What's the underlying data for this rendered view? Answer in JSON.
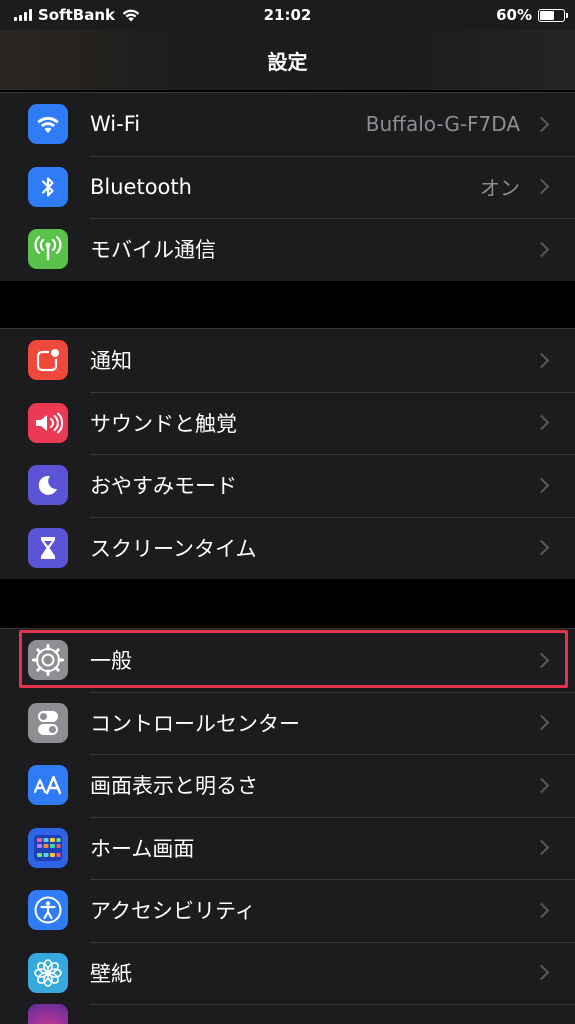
{
  "status_bar": {
    "carrier": "SoftBank",
    "time": "21:02",
    "battery_percent": "60%",
    "battery_level": 0.6,
    "icons": [
      "signal-icon",
      "wifi-icon",
      "battery-icon"
    ]
  },
  "nav": {
    "title": "設定"
  },
  "groups": [
    {
      "items": [
        {
          "label": "Wi-Fi",
          "value": "Buffalo-G-F7DA",
          "icon": "wifi-icon",
          "color": "#2f7cf6"
        },
        {
          "label": "Bluetooth",
          "value": "オン",
          "icon": "bluetooth-icon",
          "color": "#2f7cf6"
        },
        {
          "label": "モバイル通信",
          "value": "",
          "icon": "antenna-icon",
          "color": "#5ac14a"
        }
      ]
    },
    {
      "items": [
        {
          "label": "通知",
          "value": "",
          "icon": "notifications-icon",
          "color": "#f0483a"
        },
        {
          "label": "サウンドと触覚",
          "value": "",
          "icon": "speaker-icon",
          "color": "#ec3a55"
        },
        {
          "label": "おやすみモード",
          "value": "",
          "icon": "moon-icon",
          "color": "#5b54d6"
        },
        {
          "label": "スクリーンタイム",
          "value": "",
          "icon": "hourglass-icon",
          "color": "#5b54d6"
        }
      ]
    },
    {
      "items": [
        {
          "label": "一般",
          "value": "",
          "icon": "gear-icon",
          "color": "#8e8e93",
          "highlighted": true
        },
        {
          "label": "コントロールセンター",
          "value": "",
          "icon": "toggles-icon",
          "color": "#8e8e93"
        },
        {
          "label": "画面表示と明るさ",
          "value": "",
          "icon": "text-size-icon",
          "color": "#2f7cf6"
        },
        {
          "label": "ホーム画面",
          "value": "",
          "icon": "home-grid-icon",
          "color": "#2f64e6"
        },
        {
          "label": "アクセシビリティ",
          "value": "",
          "icon": "accessibility-icon",
          "color": "#2f7cf6"
        },
        {
          "label": "壁紙",
          "value": "",
          "icon": "flower-icon",
          "color": "#37a9dc"
        }
      ]
    }
  ],
  "highlight_color": "#e1334b"
}
